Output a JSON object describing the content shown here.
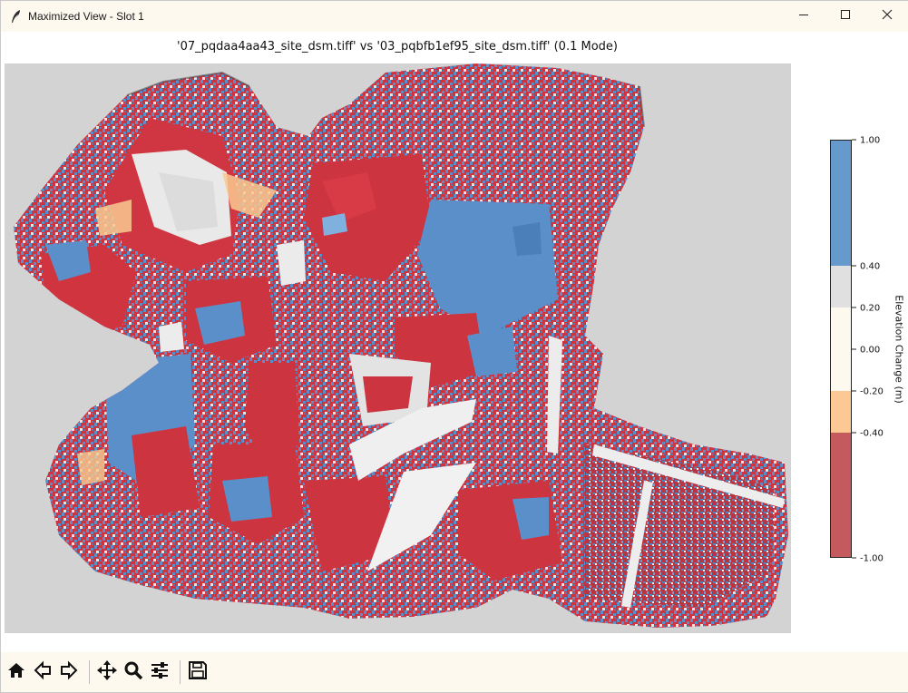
{
  "window": {
    "title": "Maximized View - Slot 1",
    "controls": [
      "minimize-icon",
      "maximize-icon",
      "close-icon"
    ]
  },
  "plot": {
    "title": "'07_pqdaa4aa43_site_dsm.tiff' vs '03_pqbfb1ef95_site_dsm.tiff' (0.1 Mode)"
  },
  "colorbar": {
    "label": "Elevation Change (m)",
    "ticks": [
      "1.00",
      "0.40",
      "0.20",
      "0.00",
      "-0.20",
      "-0.40",
      "-1.00"
    ],
    "tick_values": [
      1.0,
      0.4,
      0.2,
      0.0,
      -0.2,
      -0.4,
      -1.0
    ],
    "bins": [
      {
        "from": 0.4,
        "to": 1.0,
        "color": "#6699cc"
      },
      {
        "from": 0.2,
        "to": 0.4,
        "color": "#e0e0e0"
      },
      {
        "from": -0.2,
        "to": 0.2,
        "color": "#fdf9ef"
      },
      {
        "from": -0.4,
        "to": -0.2,
        "color": "#fcc994"
      },
      {
        "from": -1.0,
        "to": -0.4,
        "color": "#c55a5e"
      }
    ]
  },
  "colors": {
    "titlebar_bg": "#fdf9ef",
    "map_bg": "#d3d3d3",
    "gain": "#5b8fca",
    "loss": "#cc3440",
    "neutral": "#eeeeee"
  },
  "toolbar": {
    "buttons": [
      "home-icon",
      "back-icon",
      "forward-icon",
      "pan-icon",
      "zoom-icon",
      "configure-subplots-icon",
      "save-icon"
    ]
  }
}
